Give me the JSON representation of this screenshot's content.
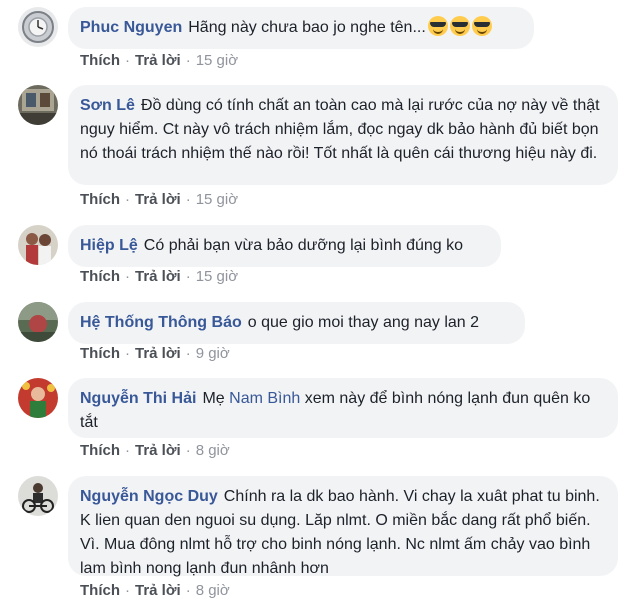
{
  "actions": {
    "like": "Thích",
    "reply": "Trả lời",
    "separator": "·"
  },
  "comments": [
    {
      "author": "Phuc Nguyen",
      "text": "Hãng này chưa bao jo nghe tên...",
      "emojis": [
        "smiling-face-with-sunglasses",
        "smiling-face-with-sunglasses",
        "smiling-face-with-sunglasses"
      ],
      "time": "15 giờ"
    },
    {
      "author": "Sơn Lê",
      "text": "Đồ dùng có tính chất an toàn cao mà lại rước của nợ này về thật nguy hiểm. Ct này vô trách nhiệm lắm, đọc ngay dk bảo hành đủ biết bọn nó thoái trách nhiệm thế nào rồi! Tốt nhất là quên cái thương hiệu này đi.",
      "time": "15 giờ"
    },
    {
      "author": "Hiệp Lệ",
      "text": "Có phải bạn vừa bảo dưỡng lại bình đúng ko",
      "time": "15 giờ"
    },
    {
      "author": "Hệ Thống Thông Báo",
      "text": "o que gio moi thay ang nay lan 2",
      "time": "9 giờ"
    },
    {
      "author": "Nguyễn Thi Hải",
      "text_before": "Mẹ",
      "mention": "Nam Bình",
      "text_after": "xem này để bình nóng lạnh đun quên ko tắt",
      "time": "8 giờ"
    },
    {
      "author": "Nguyễn Ngọc Duy",
      "text": "Chính ra la dk bao hành. Vi chay la xuât phat tu binh. K lien quan den nguoi su dụng. Lăp nlmt. O miền bắc dang rất phổ biến. Vì. Mua đông nlmt hỗ trợ cho binh nóng lạnh. Nc nlmt ấm chảy vao bình lam bình nong lạnh đun nhânh hơn",
      "time": "8 giờ"
    }
  ]
}
